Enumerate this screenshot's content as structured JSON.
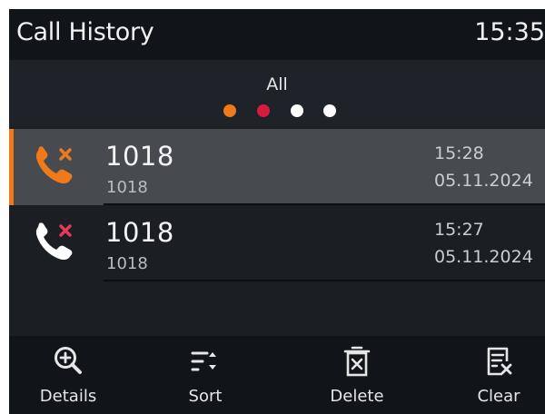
{
  "header": {
    "title": "Call History",
    "time": "15:35"
  },
  "filter": {
    "label": "All",
    "dots": [
      {
        "color": "#f07a1a",
        "active": true
      },
      {
        "color": "#d81b3c",
        "active": false
      },
      {
        "color": "#ffffff",
        "active": false
      },
      {
        "color": "#ffffff",
        "active": false
      }
    ]
  },
  "calls": [
    {
      "name": "1018",
      "number": "1018",
      "time": "15:28",
      "date": "05.11.2024",
      "type": "missed",
      "icon": "missed-call-icon",
      "icon_color": "#f07a1a",
      "mark_color": "#f07a1a",
      "selected": true
    },
    {
      "name": "1018",
      "number": "1018",
      "time": "15:27",
      "date": "05.11.2024",
      "type": "missed",
      "icon": "missed-call-icon",
      "icon_color": "#ffffff",
      "mark_color": "#e8395a",
      "selected": false
    }
  ],
  "toolbar": {
    "details_label": "Details",
    "sort_label": "Sort",
    "delete_label": "Delete",
    "clear_label": "Clear"
  },
  "colors": {
    "accent": "#f07a1a",
    "background": "#1b1f24",
    "selected_row": "#474b50"
  }
}
